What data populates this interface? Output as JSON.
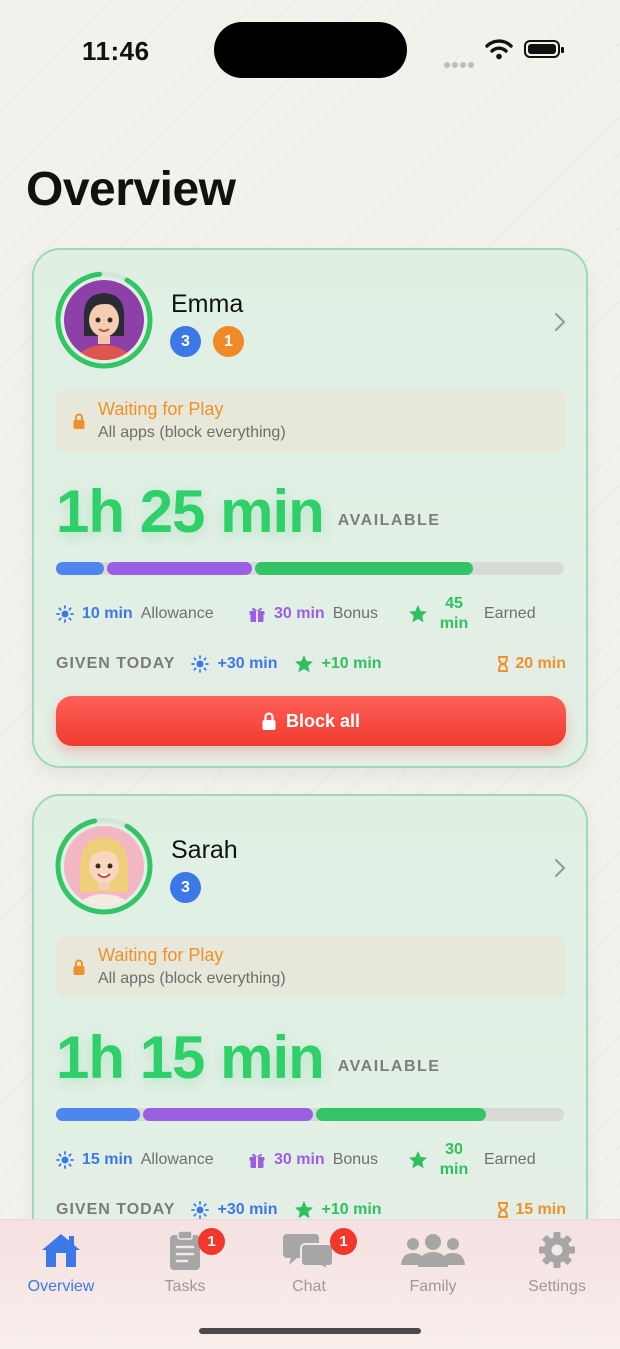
{
  "status_bar": {
    "time": "11:46"
  },
  "page": {
    "title": "Overview"
  },
  "children": [
    {
      "name": "Emma",
      "badges": [
        "3",
        "1"
      ],
      "mode_title": "Waiting for Play",
      "mode_subtitle": "All apps (block everything)",
      "available_time": "1h 25 min",
      "available_label": "AVAILABLE",
      "progress_fraction": {
        "allowance": 0.095,
        "bonus": 0.285,
        "earned": 0.43
      },
      "stats": {
        "allowance_value": "10 min",
        "allowance_label": "Allowance",
        "bonus_value": "30 min",
        "bonus_label": "Bonus",
        "earned_value_line1": "45",
        "earned_value_line2": "min",
        "earned_label": "Earned"
      },
      "given_today": {
        "label": "GIVEN TODAY",
        "allowance": "+30 min",
        "earned": "+10 min",
        "limit": "20 min"
      },
      "block_button_label": "Block all"
    },
    {
      "name": "Sarah",
      "badges": [
        "3"
      ],
      "mode_title": "Waiting for Play",
      "mode_subtitle": "All apps (block everything)",
      "available_time": "1h 15 min",
      "available_label": "AVAILABLE",
      "progress_fraction": {
        "allowance": 0.165,
        "bonus": 0.335,
        "earned": 0.335
      },
      "stats": {
        "allowance_value": "15 min",
        "allowance_label": "Allowance",
        "bonus_value": "30 min",
        "bonus_label": "Bonus",
        "earned_value_line1": "30",
        "earned_value_line2": "min",
        "earned_label": "Earned"
      },
      "given_today": {
        "label": "GIVEN TODAY",
        "allowance": "+30 min",
        "earned": "+10 min",
        "limit": "15 min"
      }
    }
  ],
  "tab_bar": {
    "tabs": [
      {
        "label": "Overview",
        "icon": "home-icon",
        "active": true
      },
      {
        "label": "Tasks",
        "icon": "clipboard-icon",
        "badge": "1"
      },
      {
        "label": "Chat",
        "icon": "chat-bubbles-icon",
        "badge": "1"
      },
      {
        "label": "Family",
        "icon": "people-icon"
      },
      {
        "label": "Settings",
        "icon": "gear-icon"
      }
    ]
  },
  "colors": {
    "accent_green": "#2fcf6a",
    "allowance_blue": "#3d78e8",
    "bonus_purple": "#9a5fe2",
    "warning_orange": "#f0902b",
    "danger_red": "#f03a2e"
  }
}
